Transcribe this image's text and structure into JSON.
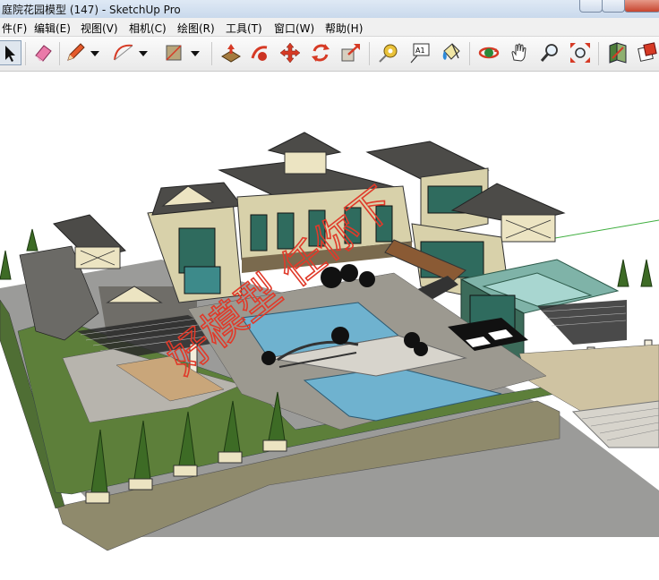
{
  "window": {
    "title": "庭院花园模型 (147) - SketchUp Pro"
  },
  "menu": {
    "items": [
      {
        "label": "件(F)"
      },
      {
        "label": "编辑(E)"
      },
      {
        "label": "视图(V)"
      },
      {
        "label": "相机(C)"
      },
      {
        "label": "绘图(R)"
      },
      {
        "label": "工具(T)"
      },
      {
        "label": "窗口(W)"
      },
      {
        "label": "帮助(H)"
      }
    ]
  },
  "toolbar": {
    "text_tool_glyph": "A1",
    "icons": [
      "select-icon",
      "eraser-icon",
      "pencil-icon",
      "arc-icon",
      "rectangle-icon",
      "push-pull-icon",
      "follow-me-icon",
      "move-icon",
      "rotate-icon",
      "scale-icon",
      "tape-measure-icon",
      "text-icon",
      "paint-bucket-icon",
      "orbit-icon",
      "pan-icon",
      "zoom-icon",
      "zoom-extents-icon",
      "previous-view-icon",
      "next-view-icon"
    ]
  },
  "viewport": {
    "watermark": "好模型 任你下",
    "colors": {
      "roof": "#4c4b48",
      "wall": "#d8d1aa",
      "glass": "#2f6b5e",
      "pool": "#6fb2cf",
      "lawn": "#5d7f3a",
      "paving": "#bdb9b2",
      "watermark": "#e03a2a"
    }
  }
}
